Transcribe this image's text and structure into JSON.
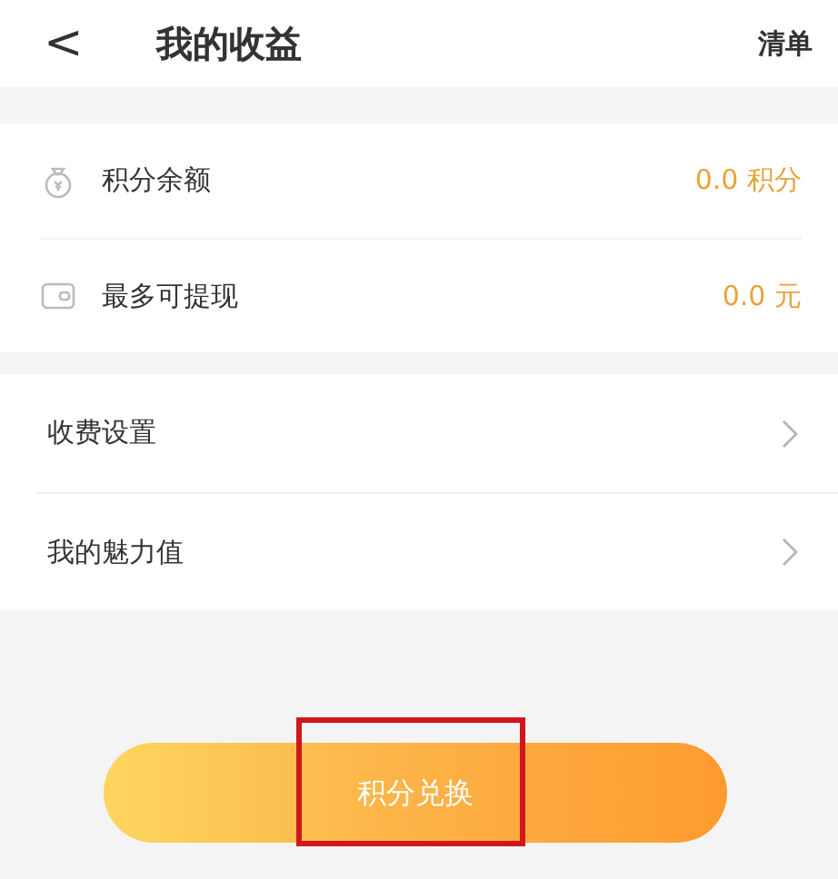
{
  "header": {
    "back": "<",
    "title": "我的收益",
    "action": "清单"
  },
  "balances": [
    {
      "kind": "coin",
      "label": "积分余额",
      "value": "0.0 积分"
    },
    {
      "kind": "wallet",
      "label": "最多可提现",
      "value": "0.0 元"
    }
  ],
  "menu": [
    {
      "label": "收费设置"
    },
    {
      "label": "我的魅力值"
    }
  ],
  "exchange_button": {
    "label": "积分兑换",
    "highlighted": true
  }
}
